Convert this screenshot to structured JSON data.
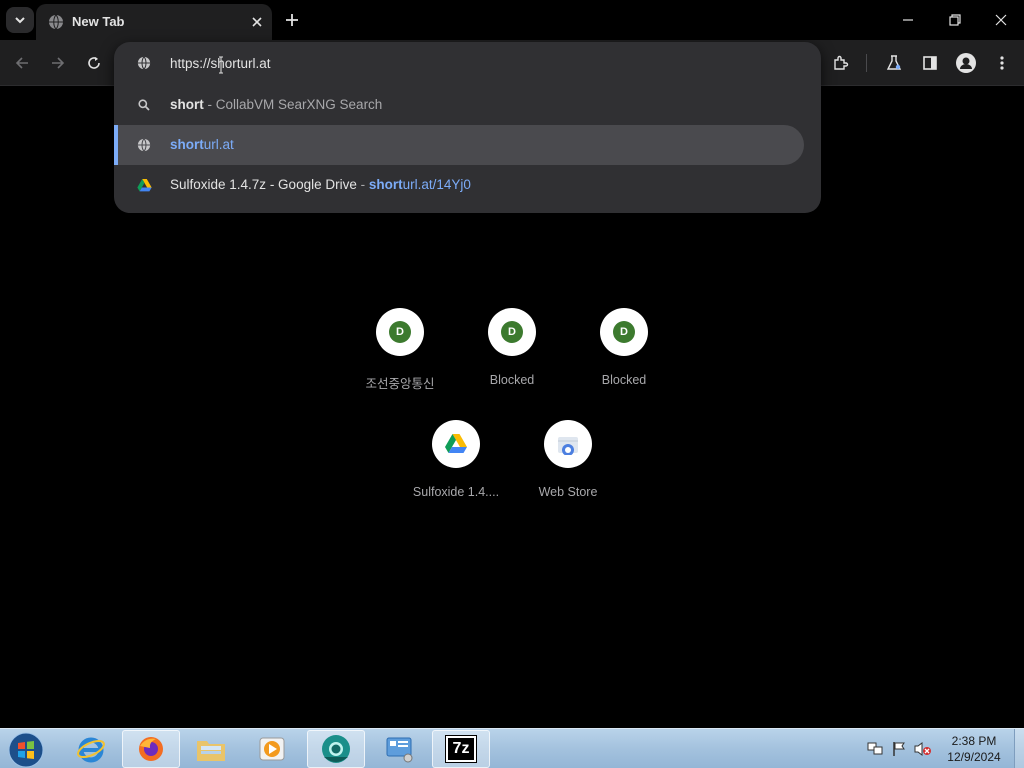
{
  "tab": {
    "title": "New Tab",
    "favicon": "globe-icon"
  },
  "omnibox": {
    "input_value": "https://shorturl.at",
    "suggestions": [
      {
        "icon": "search-icon",
        "match": "short",
        "description": "CollabVM SearXNG Search",
        "separator": " - "
      },
      {
        "icon": "globe-icon",
        "match": "short",
        "rest": "url.at",
        "selected": true
      },
      {
        "icon": "google-drive-icon",
        "title": "Sulfoxide 1.4.7z - Google Drive",
        "separator": " - ",
        "url_match": "short",
        "url_rest": "url.at/14Yj0"
      }
    ]
  },
  "shortcuts": [
    {
      "letter": "D",
      "label": "조선중앙통신"
    },
    {
      "letter": "D",
      "label": "Blocked"
    },
    {
      "letter": "D",
      "label": "Blocked"
    },
    {
      "icon": "google-drive-icon",
      "label": "Sulfoxide 1.4...."
    },
    {
      "icon": "web-store-icon",
      "label": "Web Store"
    }
  ],
  "taskbar": {
    "apps": [
      "internet-explorer",
      "firefox",
      "file-explorer",
      "media-player",
      "chrome",
      "control-panel",
      "7-zip"
    ],
    "seven_zip_label": "7z",
    "clock": {
      "time": "2:38 PM",
      "date": "12/9/2024"
    }
  },
  "colors": {
    "accent": "#7cacf8",
    "background": "#000000",
    "dropdown": "#303033",
    "taskbar": "#a4c2de"
  }
}
